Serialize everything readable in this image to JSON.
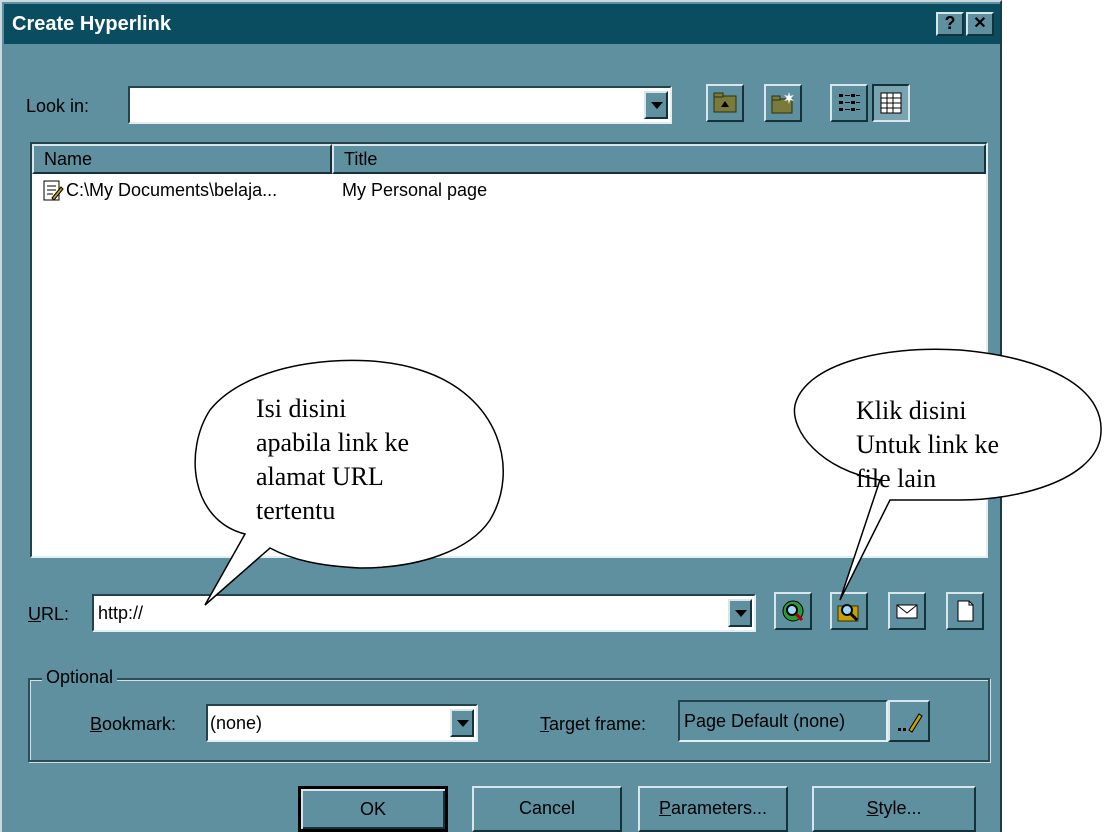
{
  "dialog": {
    "title": "Create Hyperlink",
    "help_label": "?",
    "close_label": "✕"
  },
  "look_in": {
    "label": "Look in:",
    "value": ""
  },
  "toolbar_icons": [
    "up-folder-icon",
    "new-folder-icon",
    "list-view-icon",
    "details-view-icon"
  ],
  "file_list": {
    "columns": [
      "Name",
      "Title"
    ],
    "rows": [
      {
        "name": "C:\\My Documents\\belaja...",
        "title": "My Personal page"
      }
    ]
  },
  "url": {
    "label_prefix": "U",
    "label_rest": "RL:",
    "value": "http://"
  },
  "url_icons": [
    "browse-web-icon",
    "browse-file-icon",
    "mail-icon",
    "new-page-icon"
  ],
  "optional": {
    "group_label": "Optional",
    "bookmark_label_prefix": "B",
    "bookmark_label_rest": "ookmark:",
    "bookmark_value": "(none)",
    "target_label_prefix": "T",
    "target_label_rest": "arget frame:",
    "target_value": "Page Default (none)"
  },
  "buttons": {
    "ok": "OK",
    "cancel": "Cancel",
    "parameters_prefix": "P",
    "parameters_rest": "arameters...",
    "style_prefix": "S",
    "style_rest": "tyle..."
  },
  "callouts": {
    "left_lines": [
      "Isi disini",
      "apabila link ke",
      "alamat URL",
      "tertentu"
    ],
    "right_lines": [
      "Klik disini",
      "Untuk link ke",
      "file lain"
    ]
  }
}
